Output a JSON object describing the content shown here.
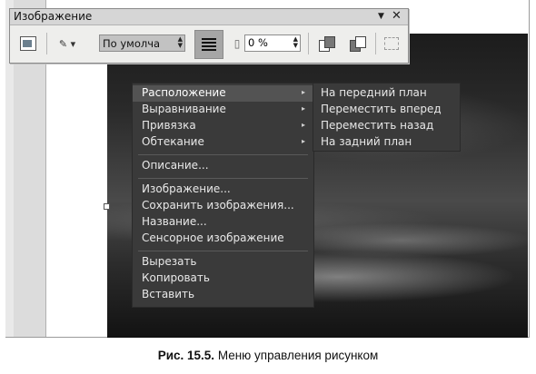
{
  "toolbar": {
    "title": "Изображение",
    "menu_icon": "▼",
    "close_icon": "✕",
    "mode_value": "По умолча",
    "transparency_value": "0 %",
    "icons": [
      "image-icon",
      "brush-icon",
      "filter-icon",
      "transparency-icon",
      "bring-front-icon",
      "send-back-icon",
      "selection-icon"
    ]
  },
  "context_menu": {
    "items": [
      {
        "label": "Расположение",
        "submenu": true,
        "active": true
      },
      {
        "label": "Выравнивание",
        "submenu": true
      },
      {
        "label": "Привязка",
        "submenu": true
      },
      {
        "label": "Обтекание",
        "submenu": true
      },
      {
        "label": "Описание...",
        "submenu": false
      },
      {
        "label": "Изображение...",
        "submenu": false
      },
      {
        "label": "Сохранить изображения...",
        "submenu": false
      },
      {
        "label": "Название...",
        "submenu": false
      },
      {
        "label": "Сенсорное изображение",
        "submenu": false
      },
      {
        "label": "Вырезать",
        "submenu": false
      },
      {
        "label": "Копировать",
        "submenu": false
      },
      {
        "label": "Вставить",
        "submenu": false
      }
    ],
    "submenu_arrow": "▸"
  },
  "submenu": {
    "items": [
      {
        "label": "На передний план"
      },
      {
        "label": "Переместить вперед"
      },
      {
        "label": "Переместить назад"
      },
      {
        "label": "На задний план"
      }
    ]
  },
  "caption": {
    "figure_label": "Рис. 15.5.",
    "text": "Меню управления рисунком"
  }
}
